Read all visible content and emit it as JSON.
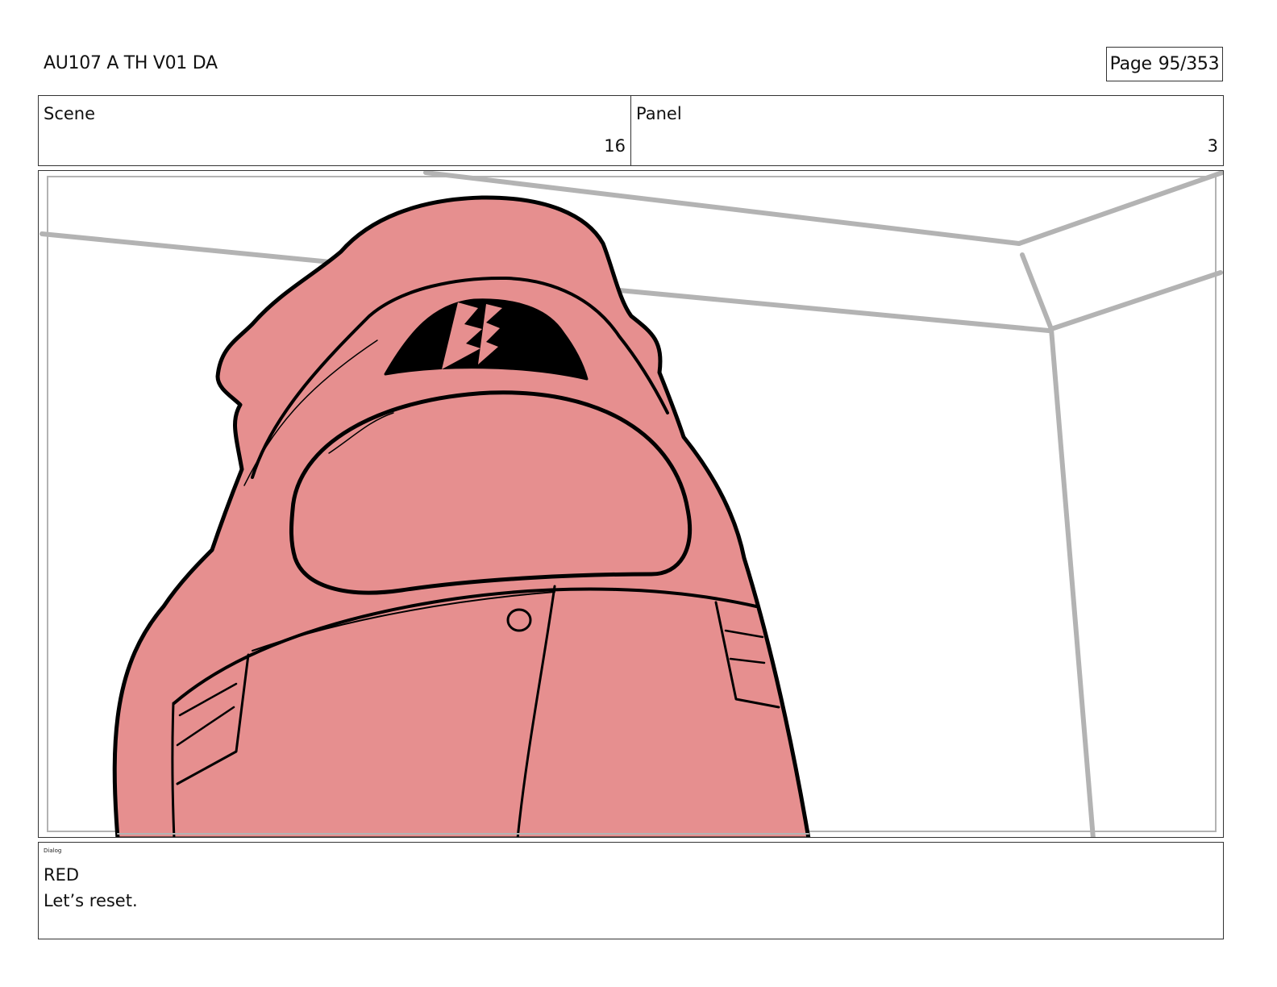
{
  "header": {
    "title": "AU107 A TH V01 DA",
    "page_label": "Page",
    "page_number": "95/353"
  },
  "info": {
    "scene_label": "Scene",
    "scene_value": "16",
    "panel_label": "Panel",
    "panel_value": "3"
  },
  "artwork": {
    "description_icon": "red-crewmate-figure",
    "colors": {
      "body_fill": "#E68F8F",
      "outline": "#000000",
      "room_lines": "#B3B3B3"
    }
  },
  "dialog": {
    "tag": "Dialog",
    "speaker": "RED",
    "line": "Let’s reset."
  }
}
